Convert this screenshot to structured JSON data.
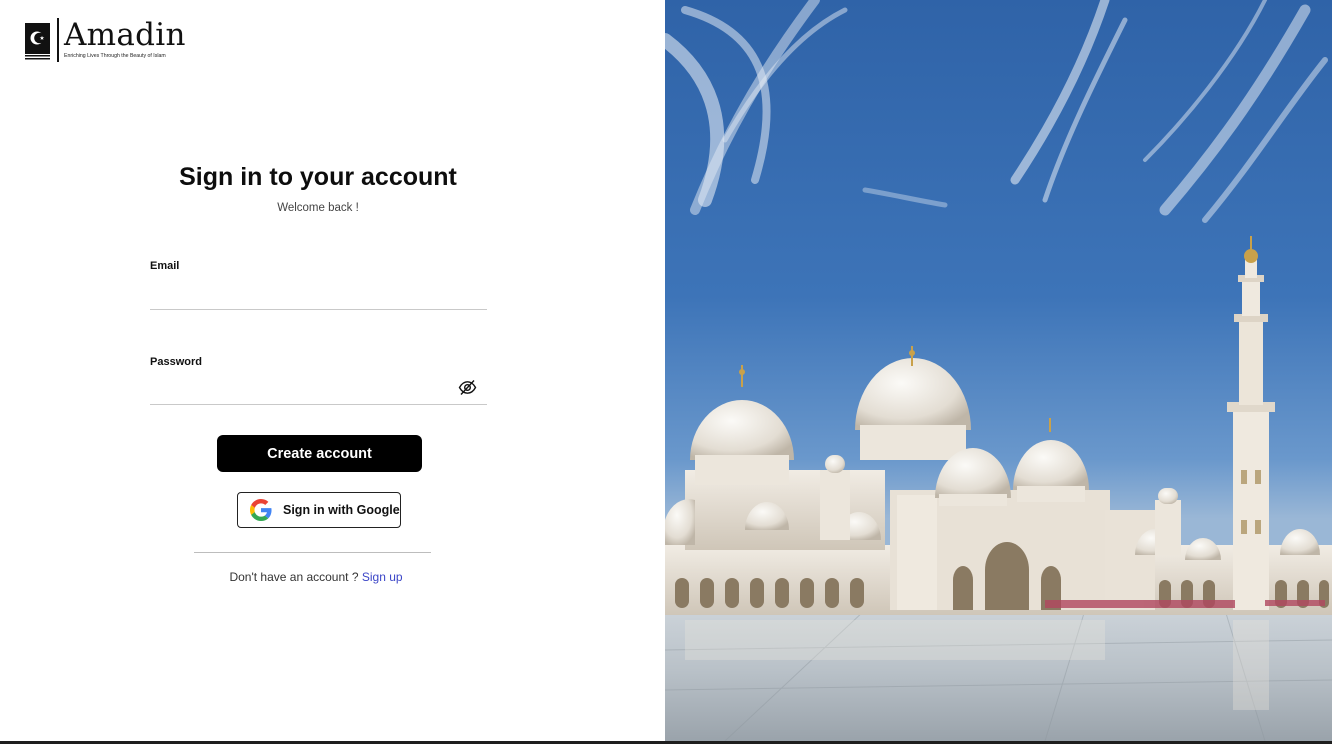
{
  "brand": {
    "name": "Amadin",
    "tagline": "Enriching Lives Through the Beauty of Islam"
  },
  "form": {
    "title": "Sign in to your account",
    "subtitle": "Welcome back !",
    "email": {
      "label": "Email",
      "value": "",
      "placeholder": ""
    },
    "password": {
      "label": "Password",
      "value": "",
      "placeholder": ""
    },
    "toggle_visibility_icon": "eye-slash-icon",
    "primary_button": "Create account",
    "google_button": "Sign in with Google",
    "google_icon": "google-g-icon",
    "footer_prompt": "Don't have an account ?",
    "footer_link": "Sign up"
  },
  "hero_image": {
    "subject": "mosque-photo"
  },
  "colors": {
    "primary_button_bg": "#000000",
    "link": "#3b45c7",
    "sky": "#2f63a8"
  }
}
